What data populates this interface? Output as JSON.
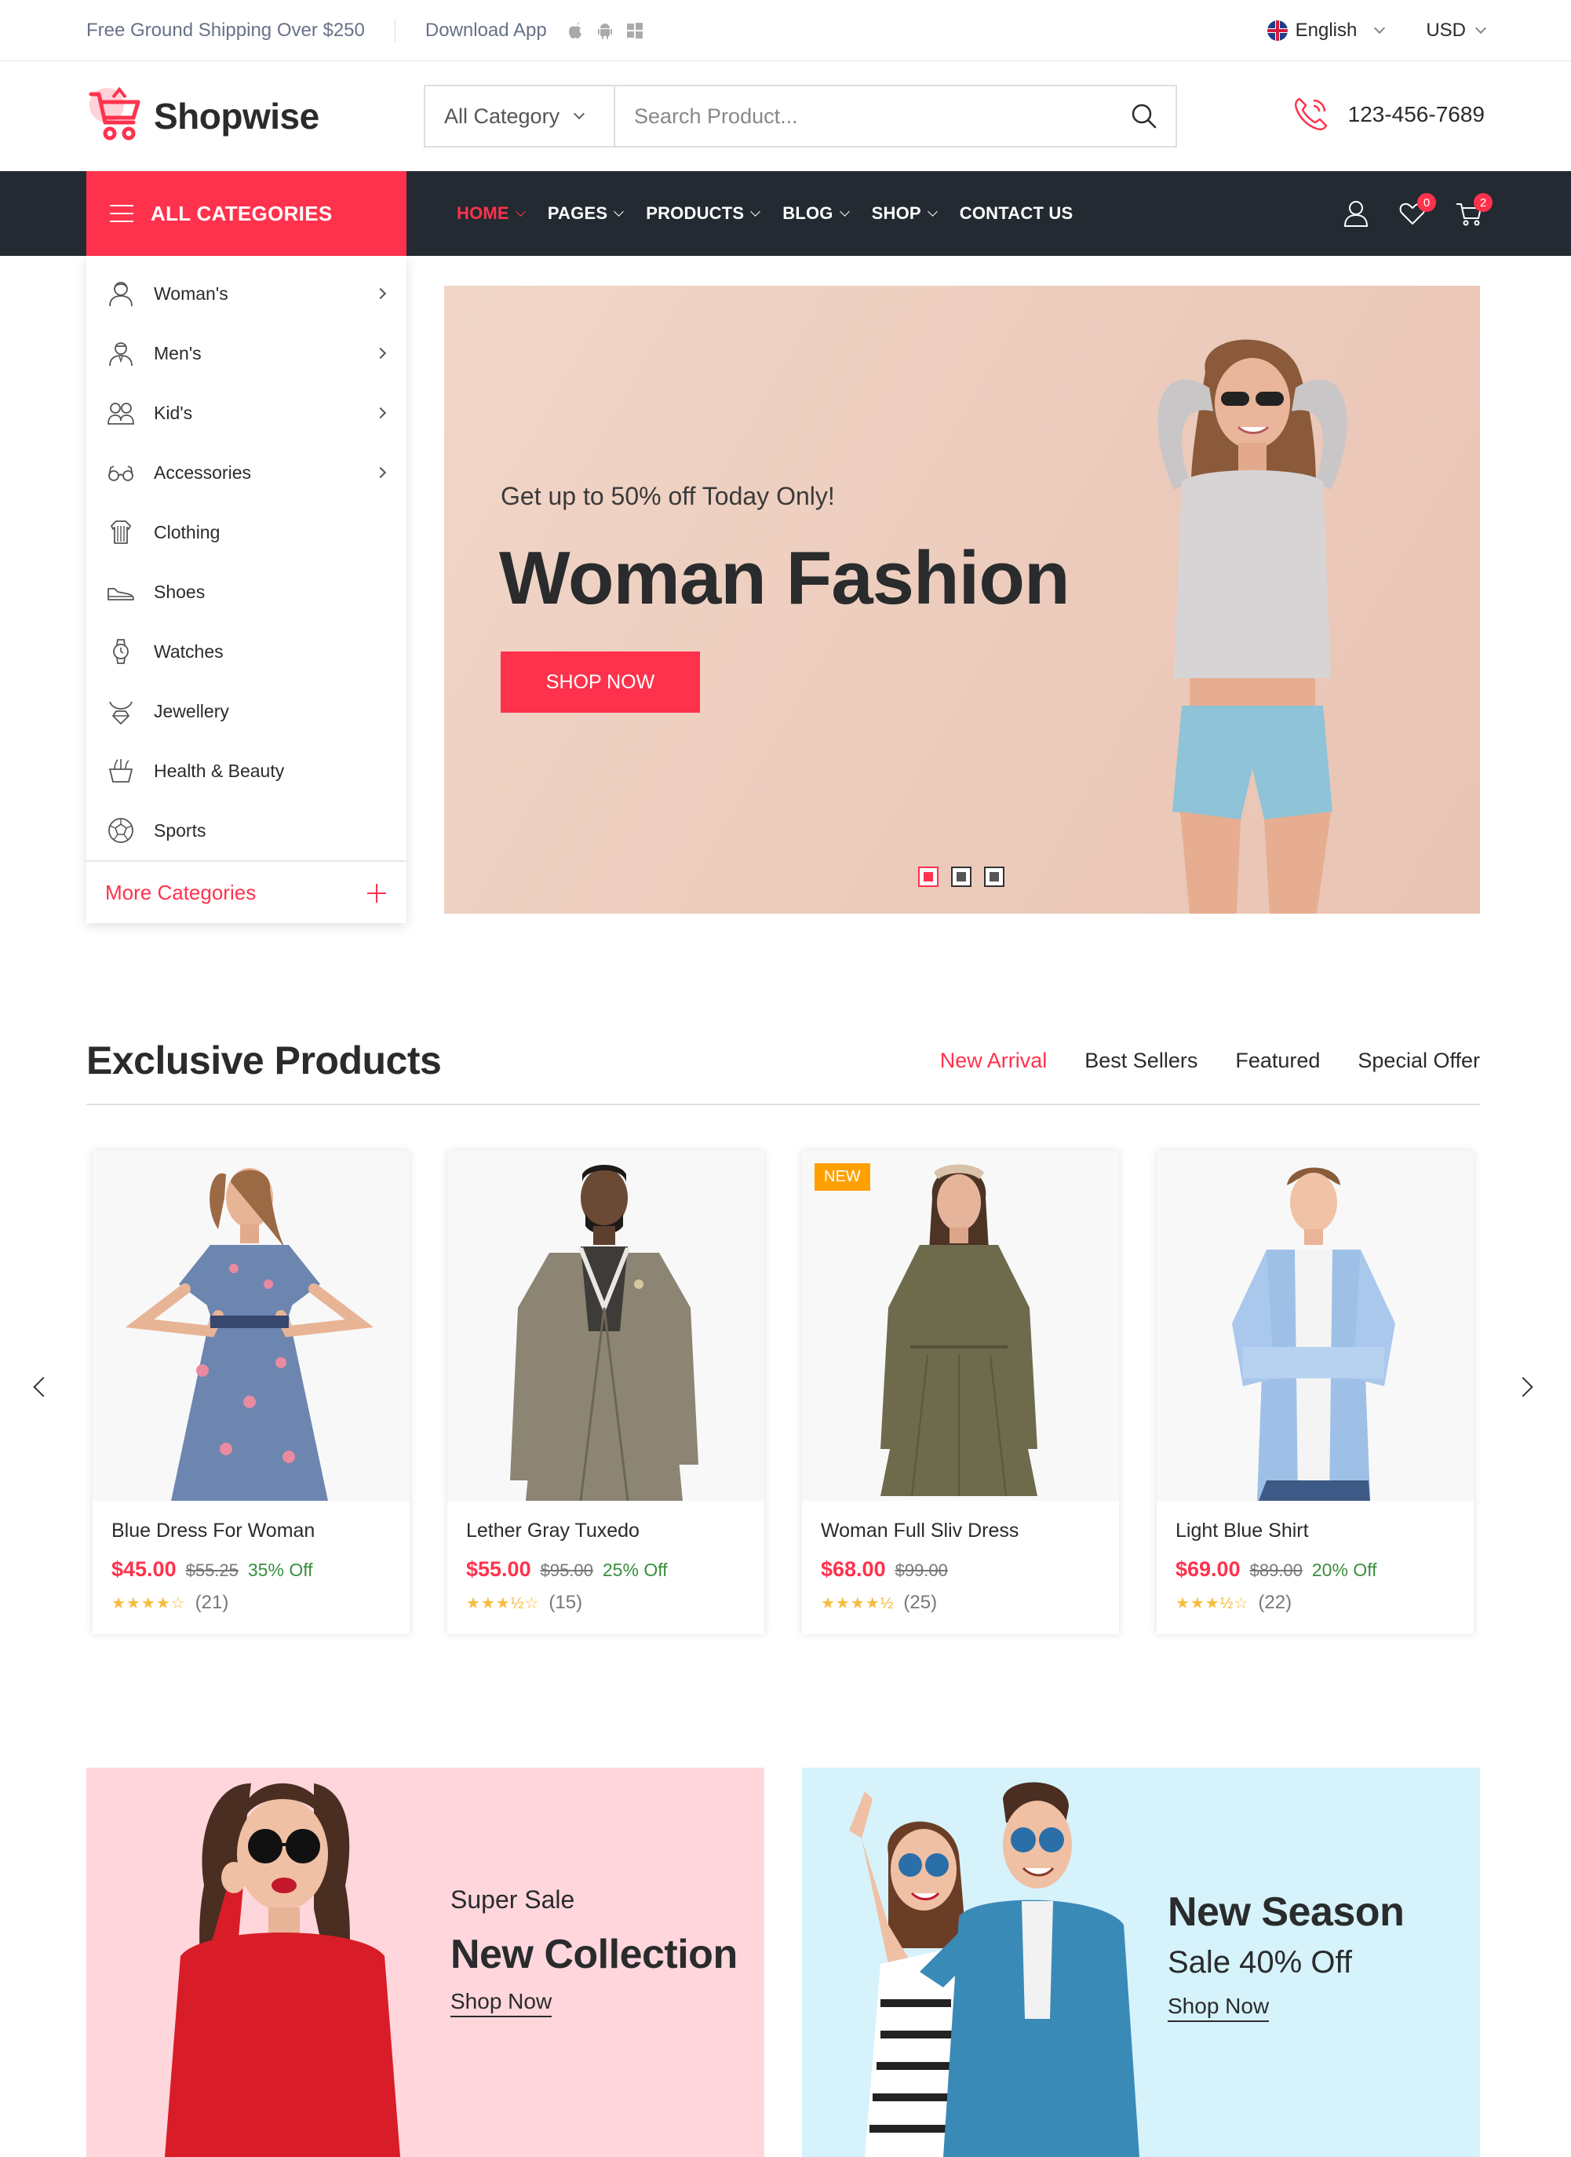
{
  "topbar": {
    "shipping_text": "Free Ground Shipping Over $250",
    "download_text": "Download App",
    "os_icons": [
      "apple-icon",
      "android-icon",
      "windows-icon"
    ],
    "language": "English",
    "currency": "USD"
  },
  "header": {
    "brand": "Shopwise",
    "category_select": "All Category",
    "search_placeholder": "Search Product...",
    "phone": "123-456-7689"
  },
  "nav": {
    "all_categories": "ALL CATEGORIES",
    "menu": [
      {
        "label": "HOME",
        "active": true
      },
      {
        "label": "PAGES"
      },
      {
        "label": "PRODUCTS"
      },
      {
        "label": "BLOG"
      },
      {
        "label": "SHOP"
      },
      {
        "label": "CONTACT US"
      }
    ],
    "wishlist_count": "0",
    "cart_count": "2"
  },
  "sidebar": {
    "items": [
      {
        "label": "Woman's",
        "icon": "woman-icon",
        "submenu": true
      },
      {
        "label": "Men's",
        "icon": "man-icon",
        "submenu": true
      },
      {
        "label": "Kid's",
        "icon": "kids-icon",
        "submenu": true
      },
      {
        "label": "Accessories",
        "icon": "glasses-icon",
        "submenu": true
      },
      {
        "label": "Clothing",
        "icon": "clothing-icon"
      },
      {
        "label": "Shoes",
        "icon": "shoe-icon"
      },
      {
        "label": "Watches",
        "icon": "watch-icon"
      },
      {
        "label": "Jewellery",
        "icon": "jewellery-icon"
      },
      {
        "label": "Health & Beauty",
        "icon": "beauty-icon"
      },
      {
        "label": "Sports",
        "icon": "sports-icon"
      }
    ],
    "more": "More Categories"
  },
  "hero": {
    "subtitle": "Get up to 50% off Today Only!",
    "title": "Woman Fashion",
    "button": "SHOP NOW",
    "slides": 3,
    "active_slide": 1
  },
  "products": {
    "title": "Exclusive Products",
    "tabs": [
      "New Arrival",
      "Best Sellers",
      "Featured",
      "Special Offer"
    ],
    "items": [
      {
        "name": "Blue Dress For Woman",
        "price": "$45.00",
        "old_price": "$55.25",
        "discount": "35% Off",
        "rating": 4,
        "reviews": "(21)"
      },
      {
        "name": "Lether Gray Tuxedo",
        "price": "$55.00",
        "old_price": "$95.00",
        "discount": "25% Off",
        "rating": 3.5,
        "reviews": "(15)"
      },
      {
        "name": "Woman Full Sliv Dress",
        "price": "$68.00",
        "old_price": "$99.00",
        "discount": "",
        "rating": 4.5,
        "reviews": "(25)",
        "badge": "NEW"
      },
      {
        "name": "Light Blue Shirt",
        "price": "$69.00",
        "old_price": "$89.00",
        "discount": "20% Off",
        "rating": 3.5,
        "reviews": "(22)"
      }
    ]
  },
  "banners": [
    {
      "line1": "Super Sale",
      "line2": "New Collection",
      "link": "Shop Now"
    },
    {
      "line1": "New Season",
      "line2": "Sale 40% Off",
      "link": "Shop Now"
    }
  ],
  "colors": {
    "accent": "#ff324d",
    "nav_bg": "#232a31",
    "discount_green": "#388e3c",
    "star": "#f6bc3e"
  }
}
